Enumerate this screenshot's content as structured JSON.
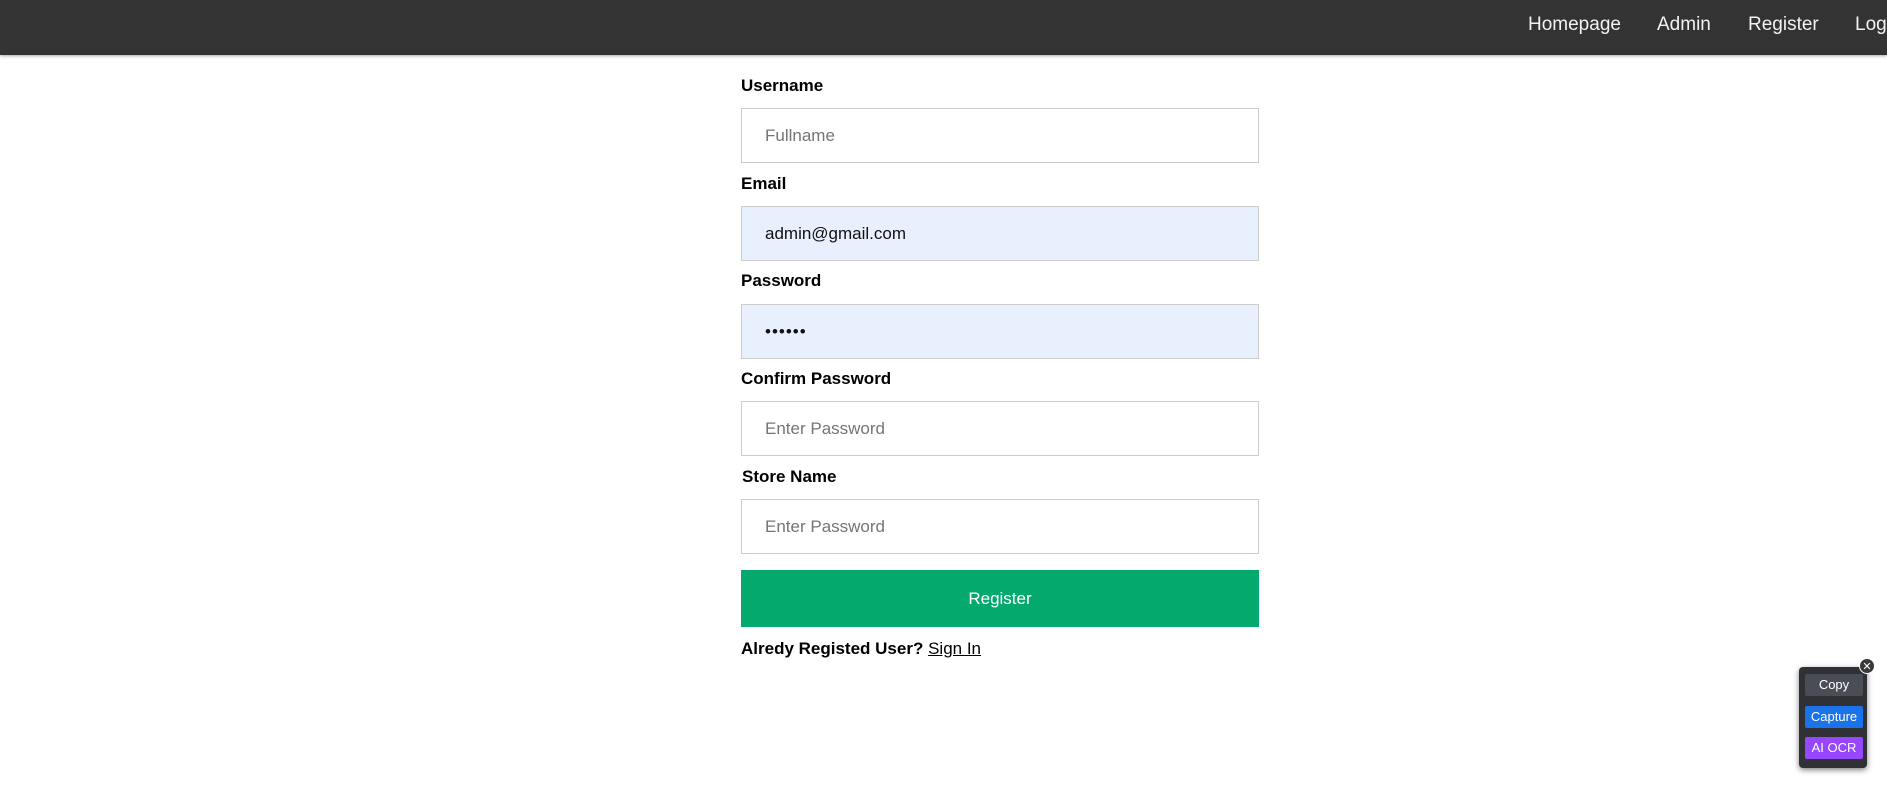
{
  "nav": {
    "items": [
      {
        "label": "Homepage"
      },
      {
        "label": "Admin"
      },
      {
        "label": "Register"
      },
      {
        "label": "Log"
      }
    ]
  },
  "form": {
    "username": {
      "label": "Username",
      "placeholder": "Fullname",
      "value": ""
    },
    "email": {
      "label": "Email",
      "placeholder": "",
      "value": "admin@gmail.com"
    },
    "password": {
      "label": "Password",
      "value": "••••••"
    },
    "confirm_password": {
      "label": "Confirm Password",
      "placeholder": "Enter Password",
      "value": ""
    },
    "store_name": {
      "label": "Store Name",
      "placeholder": "Enter Password",
      "value": ""
    },
    "submit_label": "Register",
    "signin_prompt": "Alredy Registed User?",
    "signin_link": "Sign In"
  },
  "ocr_widget": {
    "close_icon": "close-icon",
    "copy_label": "Copy",
    "capture_label": "Capture",
    "ai_ocr_label": "AI OCR",
    "colors": {
      "capture": "#1a73e8",
      "ai_ocr": "#9747ff"
    }
  },
  "colors": {
    "nav_bg": "#333333",
    "button": "#04aa6d",
    "autofill": "#e8f0fe"
  }
}
